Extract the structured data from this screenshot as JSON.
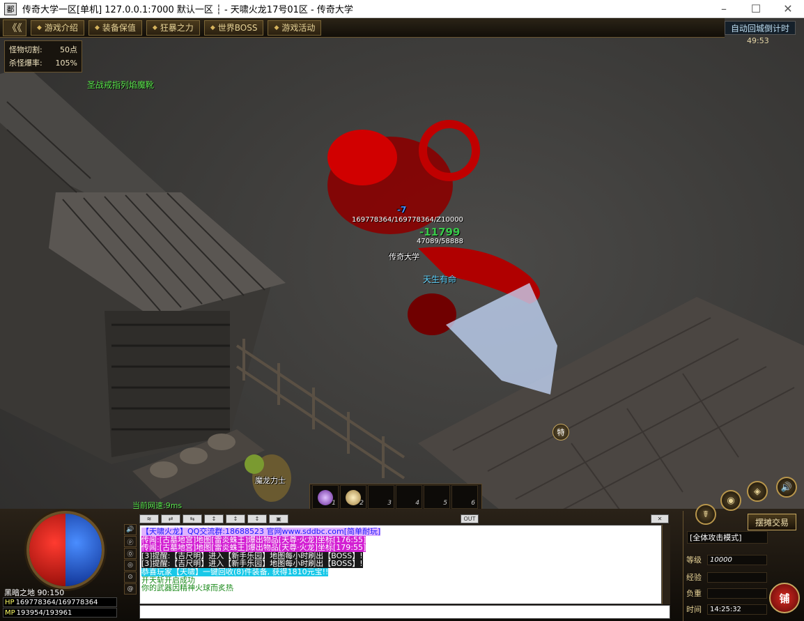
{
  "window": {
    "title": "传奇大学一区[单机] 127.0.0.1:7000  默认一区 ┆ - 天啸火龙17号01区 - 传奇大学",
    "app_icon": "鄱"
  },
  "top_nav": {
    "back_label": "《《",
    "items": [
      "游戏介绍",
      "装备保值",
      "狂暴之力",
      "世界BOSS",
      "游戏活动"
    ]
  },
  "auto_return": {
    "label": "自动回城倒计时",
    "time": "49:53"
  },
  "monster_stats": {
    "rows": [
      {
        "label": "怪物切割:",
        "value": "50点"
      },
      {
        "label": "杀怪爆率:",
        "value": "105%"
      }
    ]
  },
  "world_labels": {
    "green_npc": "圣战戒指列焰魔靴",
    "boss_hp": "169778364/169778364/Z10000",
    "damage_number": "-11799",
    "target_tag": "-7",
    "player_hp": "47089/58888",
    "player_name": "传奇大学",
    "player_title": "天生有命",
    "npc_name": "魔龙力士",
    "special_icon": "特"
  },
  "net_speed": "当前网速:9ms",
  "hotbar": {
    "slots": [
      {
        "num": "1",
        "item": "purple-orb"
      },
      {
        "num": "2",
        "item": "gold-orb"
      },
      {
        "num": "3",
        "item": ""
      },
      {
        "num": "4",
        "item": ""
      },
      {
        "num": "5",
        "item": ""
      },
      {
        "num": "6",
        "item": ""
      }
    ]
  },
  "status": {
    "map": "黑暗之地",
    "coords": "90:150",
    "hp_label": "HP",
    "hp": "169778364/169778364",
    "mp_label": "MP",
    "mp": "193954/193961"
  },
  "chat_tools": [
    "≋",
    "⇄",
    "⇆",
    "↕",
    "↕",
    "↕",
    "▣"
  ],
  "chat_out": "OUT",
  "chat_close": "✕",
  "side_icons": [
    "🔊",
    "ⓟ",
    "⓪",
    "◎",
    "⊙",
    "@"
  ],
  "chat": {
    "lines": [
      {
        "text": "【天啸火龙】QQ交流群:18688523 官网www.sddbc.com[简单耐玩]",
        "fg": "#1a1aff",
        "bg": "#e0b3ff"
      },
      {
        "text": "传闻:[古墓地宫]地图[雷炎蛛王]爆出物品[天尊·火龙]坐标[176:55]",
        "fg": "#ffffff",
        "bg": "#d320d3"
      },
      {
        "text": "传闻:[古墓地宫]地图[雷炎蛛王]爆出物品[天尊·火龙]坐标[179:55]",
        "fg": "#ffffff",
        "bg": "#d320d3"
      },
      {
        "text": "[3]提醒:【吉尺明】进入【新手乐园】地图每小时刷出【BOSS】!",
        "fg": "#ffffff",
        "bg": "#1a1a1a"
      },
      {
        "text": "[3]提醒:【吉尺明】进入【新手乐园】地图每小时刷出【BOSS】!",
        "fg": "#ffffff",
        "bg": "#1a1a1a"
      },
      {
        "text": "恭喜玩家【天啸】一键回收(8)件装备, 获得1810元宝!!",
        "fg": "#ffffff",
        "bg": "#18c8e8"
      },
      {
        "text": "开天斩开启成功",
        "fg": "#1a8a1a",
        "bg": ""
      },
      {
        "text": "你的武器因精神火球而炙热",
        "fg": "#1a8a1a",
        "bg": ""
      }
    ]
  },
  "right_panel": {
    "stall_label": "摆摊交易",
    "attack_mode": "[全体攻击模式]",
    "level_label": "等级",
    "level": "10000",
    "exp_label": "经验",
    "exp": "",
    "load_label": "负重",
    "load": "",
    "time_label": "时间",
    "time": "14:25:32",
    "shop_label": "铺",
    "round_buttons": [
      "◉",
      "◈",
      "✦",
      "🔊",
      "☤"
    ]
  }
}
